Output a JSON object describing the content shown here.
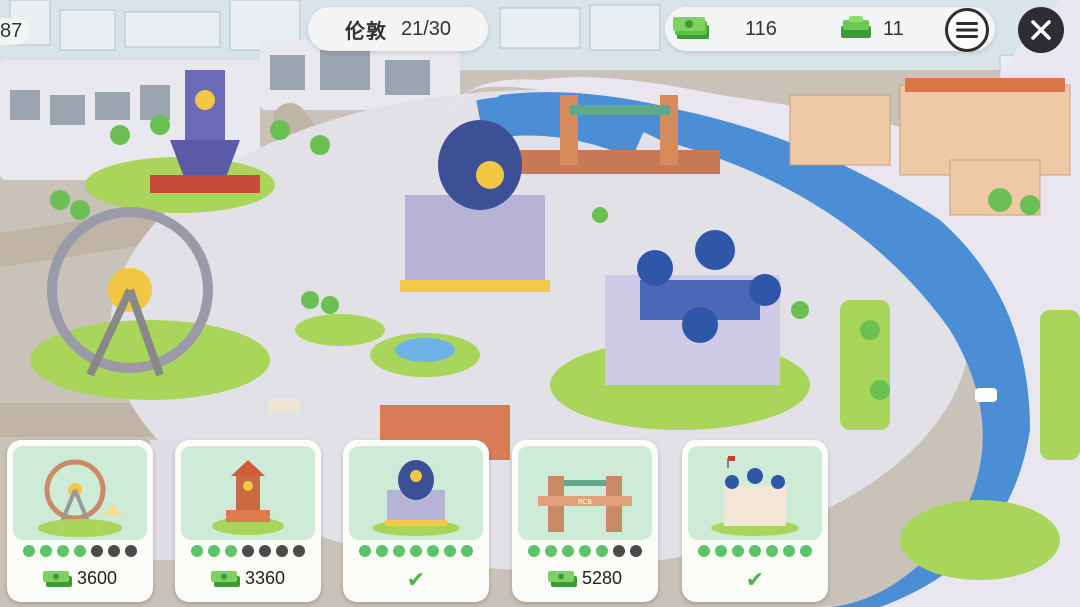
{
  "hud": {
    "partial_counter": "87",
    "city_name": "伦敦",
    "city_progress": "21/30",
    "cash": "116",
    "gems": "11",
    "menu_icon": "hamburger-icon",
    "close_icon": "close-x-icon"
  },
  "cards": [
    {
      "name": "ferris-wheel",
      "dots_filled": 4,
      "dots_total": 7,
      "price": "3600",
      "owned": false
    },
    {
      "name": "clock-tower",
      "dots_filled": 3,
      "dots_total": 7,
      "price": "3360",
      "owned": false
    },
    {
      "name": "palace",
      "dots_filled": 7,
      "dots_total": 7,
      "price": "",
      "owned": true
    },
    {
      "name": "tower-bridge",
      "dots_filled": 5,
      "dots_total": 7,
      "price": "5280",
      "owned": false
    },
    {
      "name": "castle",
      "dots_filled": 7,
      "dots_total": 7,
      "price": "",
      "owned": true
    }
  ],
  "colors": {
    "accent_green": "#5cc46a",
    "dot_off": "#4a4a4a",
    "check": "#4db548",
    "river": "#4b8ed6",
    "grass": "#a9d65a"
  }
}
